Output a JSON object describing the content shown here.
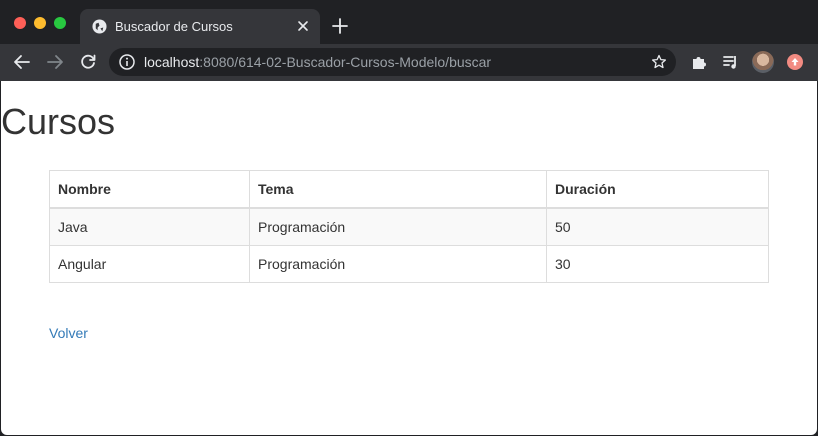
{
  "browser": {
    "tab": {
      "title": "Buscador de Cursos"
    },
    "address": {
      "host": "localhost",
      "rest": ":8080/614-02-Buscador-Cursos-Modelo/buscar"
    },
    "icons": {
      "favicon": "globe-icon",
      "close": "close-icon",
      "new_tab": "plus-icon",
      "back": "arrow-left-icon",
      "forward": "arrow-right-icon",
      "reload": "reload-icon",
      "info": "info-icon",
      "bookmark": "star-icon",
      "extensions": "puzzle-icon",
      "media": "media-queue-icon",
      "update": "update-icon"
    }
  },
  "page": {
    "title": "Cursos",
    "table": {
      "headers": [
        "Nombre",
        "Tema",
        "Duración"
      ],
      "rows": [
        [
          "Java",
          "Programación",
          "50"
        ],
        [
          "Angular",
          "Programación",
          "30"
        ]
      ]
    },
    "back_link": "Volver"
  },
  "colors": {
    "link": "#337ab7",
    "text": "#333333",
    "table_border": "#dddddd",
    "stripe": "#f9f9f9",
    "chrome_dark": "#202124",
    "chrome_toolbar": "#35363a"
  }
}
